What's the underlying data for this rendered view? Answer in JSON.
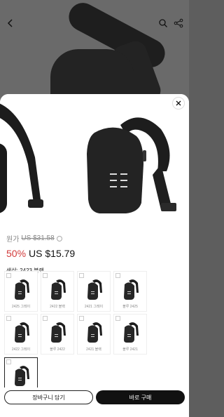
{
  "background": {
    "back_icon": "chevron-left-icon",
    "search_icon": "search-icon",
    "share_icon": "share-icon"
  },
  "sheet": {
    "close_icon": "close-icon",
    "original_price_label": "원가",
    "original_price": "US $31.58",
    "discount": "50%",
    "price": "US $15.79",
    "color_label": "색상: 2423 블랙",
    "options": [
      {
        "label": "2425 그레이",
        "selected": false
      },
      {
        "label": "2422 블랙",
        "selected": false
      },
      {
        "label": "2421 그레이",
        "selected": false
      },
      {
        "label": "블루 2425",
        "selected": false
      },
      {
        "label": "2422 그레이",
        "selected": false
      },
      {
        "label": "블루 2422",
        "selected": false
      },
      {
        "label": "2421 블랙",
        "selected": false
      },
      {
        "label": "블루 2421",
        "selected": false
      },
      {
        "label": "",
        "selected": true
      }
    ],
    "add_to_cart": "장바구니 담기",
    "buy_now": "바로 구매"
  }
}
